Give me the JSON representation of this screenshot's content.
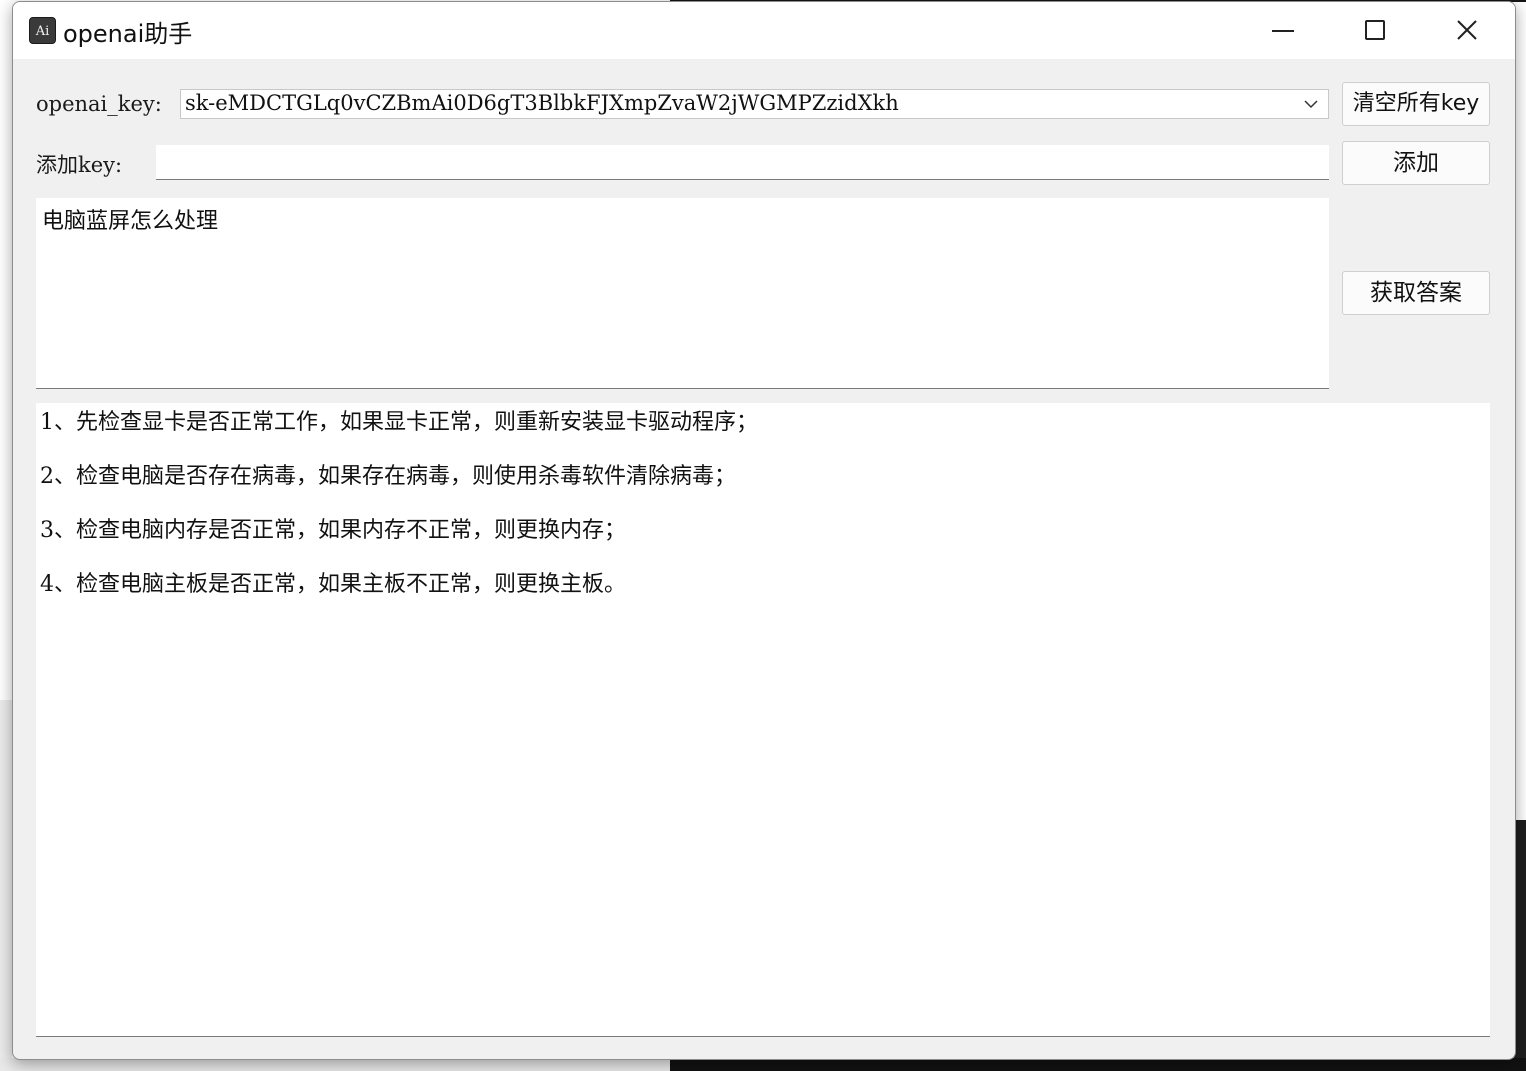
{
  "window": {
    "title": "openai助手",
    "icon": "app-icon",
    "icon_text": "Ai",
    "controls": [
      "minimize-icon",
      "maximize-icon",
      "close-icon"
    ]
  },
  "key_row": {
    "label": "openai_key:",
    "selected_key": "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",
    "clear_button": "清空所有key"
  },
  "add_row": {
    "label": "添加key:",
    "value": "",
    "add_button": "添加"
  },
  "question": {
    "text": "电脑蓝屏怎么处理",
    "submit_button": "获取答案"
  },
  "answer": {
    "lines": [
      "1、先检查显卡是否正常工作，如果显卡正常，则重新安装显卡驱动程序；",
      "2、检查电脑是否存在病毒，如果存在病毒，则使用杀毒软件清除病毒；",
      "3、检查电脑内存是否正常，如果内存不正常，则更换内存；",
      "4、检查电脑主板是否正常，如果主板不正常，则更换主板。"
    ]
  }
}
